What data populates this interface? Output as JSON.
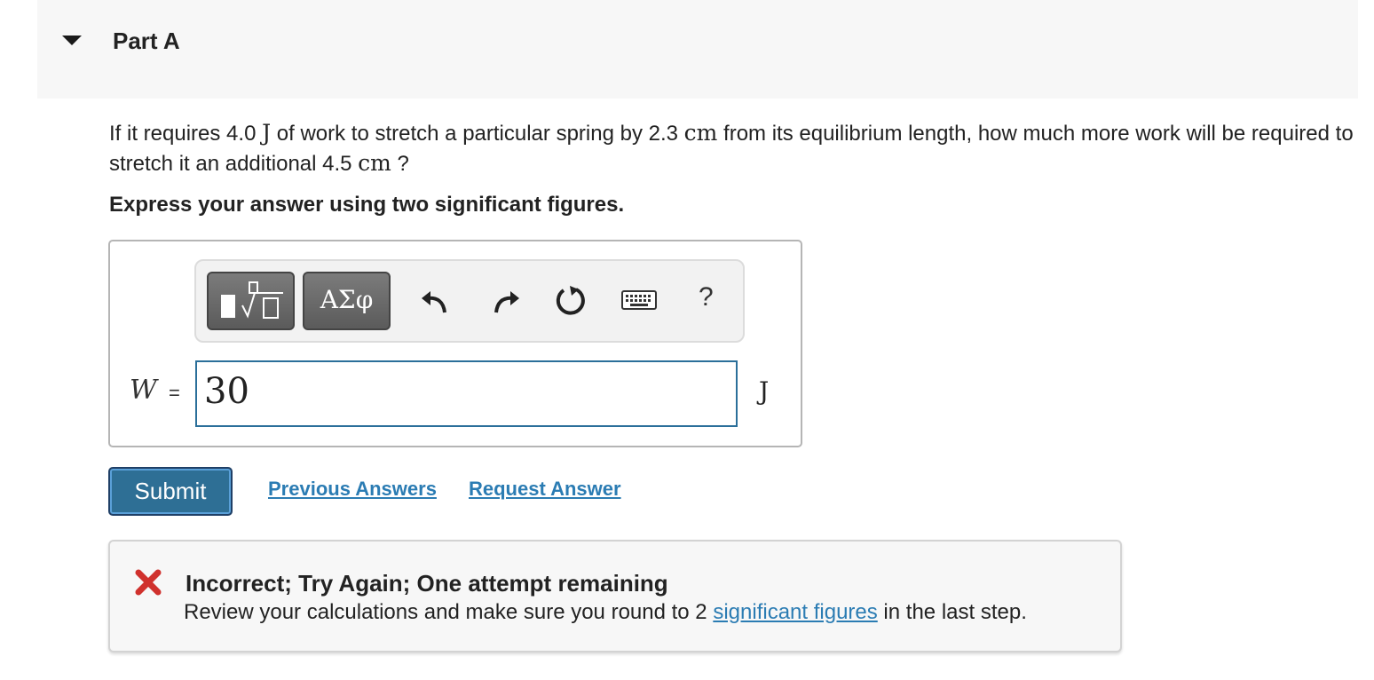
{
  "part": {
    "title": "Part A"
  },
  "question": {
    "p1": "If it requires 4.0 ",
    "u1": "J",
    "p2": " of work to stretch a particular spring by 2.3 ",
    "u2": "cm",
    "p3": " from its equilibrium length, how much more work will be required to stretch it an additional 4.5 ",
    "u3": "cm",
    "p4": " ?"
  },
  "instruction": "Express your answer using two significant figures.",
  "toolbar": {
    "symbols_label": "ΑΣφ",
    "help_label": "?",
    "icons": [
      "templates-icon",
      "undo-icon",
      "redo-icon",
      "reset-icon",
      "keyboard-icon",
      "help-icon"
    ]
  },
  "answer": {
    "variable": "W",
    "equals": "=",
    "value": "30",
    "unit": "J"
  },
  "actions": {
    "submit": "Submit",
    "previous_answers": "Previous Answers",
    "request_answer": "Request Answer"
  },
  "feedback": {
    "title": "Incorrect; Try Again; One attempt remaining",
    "text_before": "Review your calculations and make sure you round to 2 ",
    "link": "significant figures",
    "text_after": " in the last step.",
    "status_color": "#d0312d"
  }
}
